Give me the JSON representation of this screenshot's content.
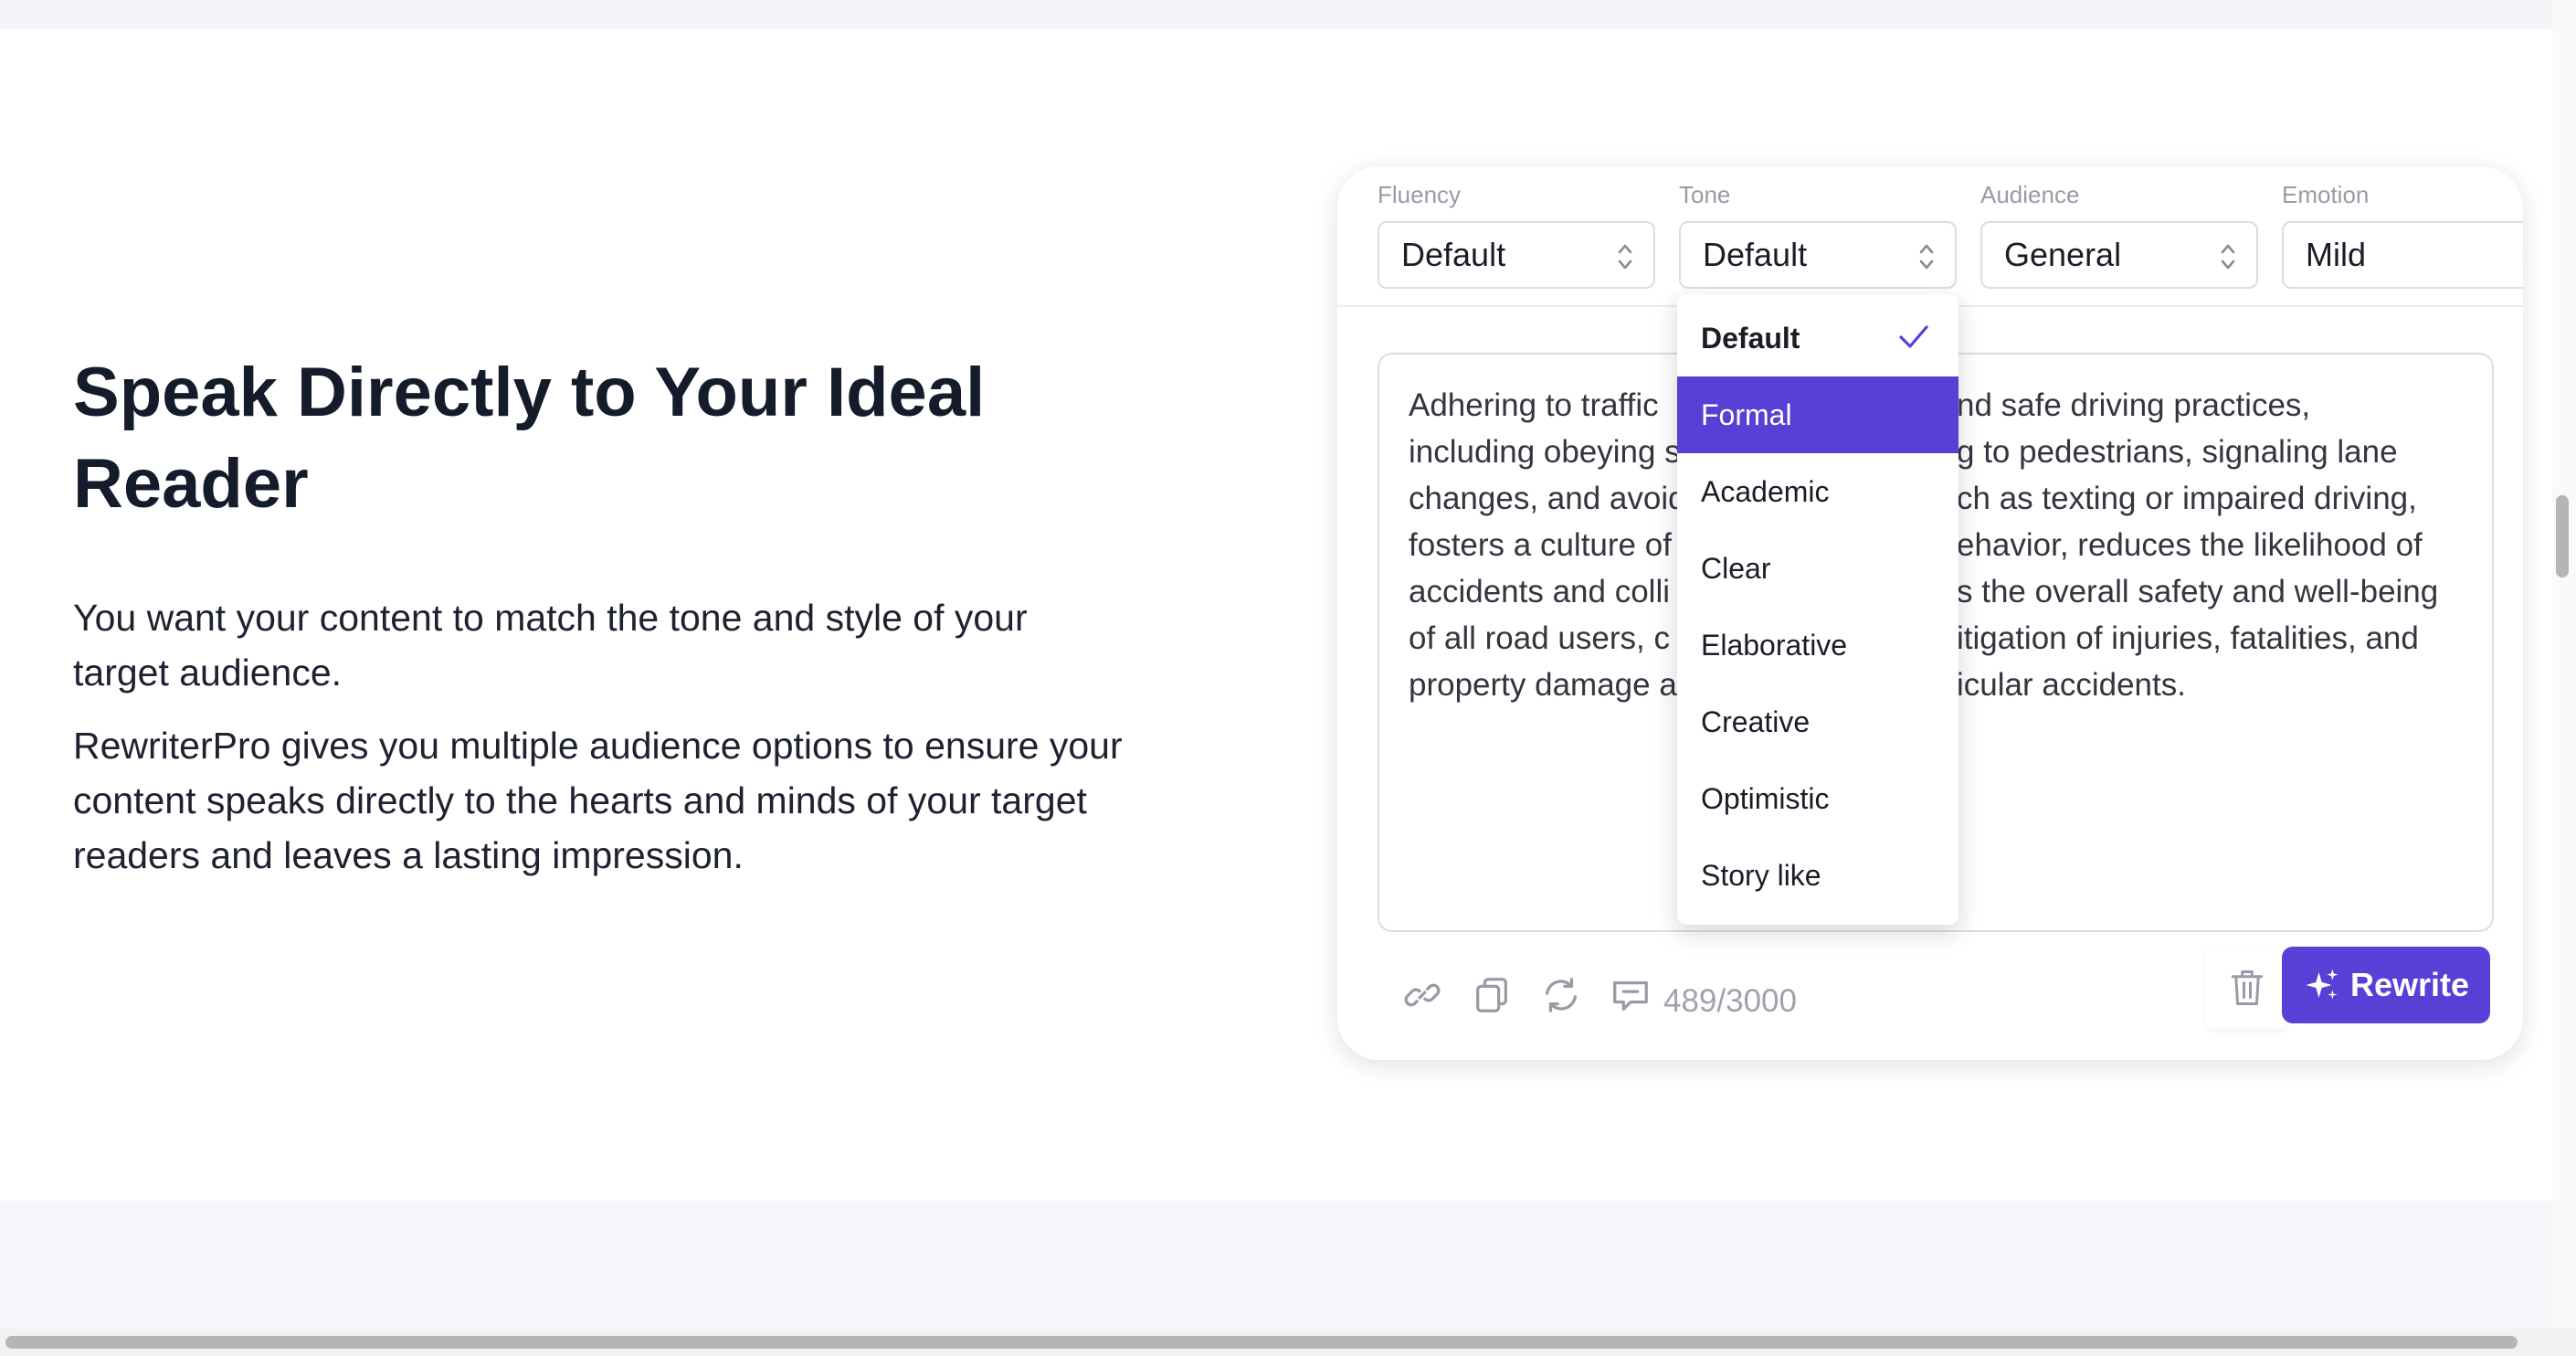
{
  "hero": {
    "heading": "Speak Directly to Your Ideal Reader",
    "paragraph_1": "You want your content to match the tone and style of your target audience.",
    "paragraph_2": "RewriterPro gives you multiple audience options to ensure your content speaks directly to the hearts and minds of your target readers and leaves a lasting impression."
  },
  "controls": {
    "fluency": {
      "label": "Fluency",
      "value": "Default"
    },
    "tone": {
      "label": "Tone",
      "value": "Default"
    },
    "audience": {
      "label": "Audience",
      "value": "General"
    },
    "emotion": {
      "label": "Emotion",
      "value": "Mild"
    }
  },
  "editor": {
    "text": "Adhering to traffic\nincluding obeying s\nchanges, and avoid\nfosters a culture of\naccidents and colli\nof all road users, c\nproperty damage a",
    "text_right": "nd safe driving practices,\ng to pedestrians, signaling lane\nch as texting or impaired driving,\nehavior, reduces the likelihood of\ns the overall safety and well-being\nitigation of injuries, fatalities, and\nicular accidents."
  },
  "dropdown": {
    "options": [
      "Default",
      "Formal",
      "Academic",
      "Clear",
      "Elaborative",
      "Creative",
      "Optimistic",
      "Story like"
    ],
    "selected": "Default",
    "highlighted": "Formal"
  },
  "toolbar": {
    "counter": "489/3000",
    "rewrite_label": "Rewrite",
    "icons": [
      "link-icon",
      "copy-icon",
      "refresh-icon",
      "feedback-icon",
      "trash-icon",
      "sparkle-icon"
    ]
  },
  "colors": {
    "accent": "#5a3fd6",
    "heading": "#141b2b",
    "muted": "#9a9aa6"
  }
}
